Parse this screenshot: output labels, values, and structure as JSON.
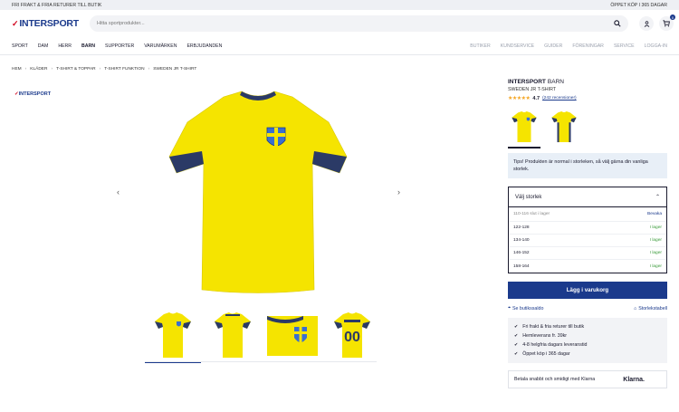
{
  "topbar": {
    "left": "FRI FRAKT & FRIA RETURER TILL BUTIK",
    "right": "ÖPPET KÖP I 365 DAGAR"
  },
  "logo": {
    "text": "INTERSPORT"
  },
  "search": {
    "placeholder": "Hitta sportprodukter..."
  },
  "header": {
    "cart_count": "0"
  },
  "nav": {
    "left": [
      "SPORT",
      "DAM",
      "HERR",
      "BARN",
      "SUPPORTER",
      "VARUMÄRKEN",
      "ERBJUDANDEN"
    ],
    "right": [
      "BUTIKER",
      "KUNDSERVICE",
      "GUIDER",
      "FÖRENINGAR",
      "SERVICE",
      "LOGGA-IN"
    ],
    "active": "BARN"
  },
  "breadcrumb": [
    "HEM",
    "KLÄDER",
    "T-SHIRT & TOPPAR",
    "T-SHIRT FUNKTION",
    "SWEDEN JR T-SHIRT"
  ],
  "gallery": {
    "brand_logo": "INTERSPORT",
    "prev_icon": "chevron-left-icon",
    "next_icon": "chevron-right-icon"
  },
  "product": {
    "brand": "INTERSPORT",
    "category": "BARN",
    "name": "SWEDEN JR T-SHIRT",
    "rating": "4.7",
    "rating_value": 4.7,
    "reviews": "(242 recensioner)"
  },
  "tip": "Tips! Produkten är normal i storleken, så välj gärna din vanliga storlek.",
  "size": {
    "label": "Välj storlek",
    "rows": [
      {
        "size": "110-116 slut i lager",
        "status": "Bevaka"
      },
      {
        "size": "122-128",
        "status": "I lager"
      },
      {
        "size": "134-140",
        "status": "I lager"
      },
      {
        "size": "146-152",
        "status": "I lager"
      },
      {
        "size": "158-164",
        "status": "I lager"
      }
    ]
  },
  "actions": {
    "add_to_cart": "Lägg i varukorg",
    "store_stock": "Se butikssaldo",
    "size_chart": "Storlekstabell"
  },
  "usps": [
    "Fri frakt & fria returer till butik",
    "Hemleverans fr. 39kr",
    "4-8 helgfria dagars leveranstid",
    "Öppet köp i 365 dagar"
  ],
  "klarna": {
    "text": "Betala snabbt och smidigt med Klarna",
    "logo": "Klarna."
  },
  "colors": {
    "brand_blue": "#1b3a8c",
    "shirt_yellow": "#f5e400",
    "shirt_navy": "#2b3a66",
    "stock_green": "#3a9b3a"
  }
}
